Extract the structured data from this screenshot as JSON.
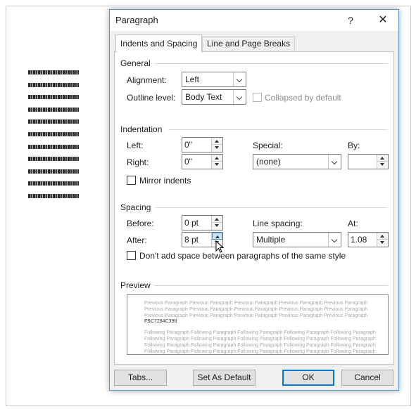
{
  "dialog": {
    "title": "Paragraph",
    "help": "?",
    "close": "✕"
  },
  "tabs": [
    {
      "label": "Indents and Spacing",
      "active": true
    },
    {
      "label": "Line and Page Breaks",
      "active": false
    }
  ],
  "general": {
    "heading": "General",
    "alignment_label": "Alignment:",
    "alignment_value": "Left",
    "outline_label": "Outline level:",
    "outline_value": "Body Text",
    "collapsed_label": "Collapsed by default"
  },
  "indentation": {
    "heading": "Indentation",
    "left_label": "Left:",
    "left_value": "0\"",
    "right_label": "Right:",
    "right_value": "0\"",
    "special_label": "Special:",
    "special_value": "(none)",
    "by_label": "By:",
    "by_value": "",
    "mirror_label": "Mirror indents"
  },
  "spacing": {
    "heading": "Spacing",
    "before_label": "Before:",
    "before_value": "0 pt",
    "after_label": "After:",
    "after_value": "8 pt",
    "line_spacing_label": "Line spacing:",
    "line_spacing_value": "Multiple",
    "at_label": "At:",
    "at_value": "1.08",
    "dont_add_label": "Don't add space between paragraphs of the same style"
  },
  "preview": {
    "heading": "Preview",
    "previous_lines": [
      "Previous Paragraph Previous Paragraph Previous Paragraph Previous Paragraph Previous Paragraph",
      "Previous Paragraph Previous Paragraph Previous Paragraph Previous Paragraph Previous Paragraph",
      "Previous Paragraph Previous Paragraph Previous Paragraph Previous Paragraph Previous Paragraph"
    ],
    "sample": "FBC7284C398",
    "following_lines": [
      "Following Paragraph Following Paragraph Following Paragraph Following Paragraph Following Paragraph",
      "Following Paragraph Following Paragraph Following Paragraph Following Paragraph Following Paragraph",
      "Following Paragraph Following Paragraph Following Paragraph Following Paragraph Following Paragraph",
      "Following Paragraph Following Paragraph Following Paragraph Following Paragraph Following Paragraph"
    ]
  },
  "buttons": {
    "tabs": "Tabs...",
    "set_default": "Set As Default",
    "ok": "OK",
    "cancel": "Cancel"
  },
  "colors": {
    "dialog_border": "#5a9bd5",
    "default_button": "#0078d7",
    "spinner_hover": "#cde6f7"
  }
}
